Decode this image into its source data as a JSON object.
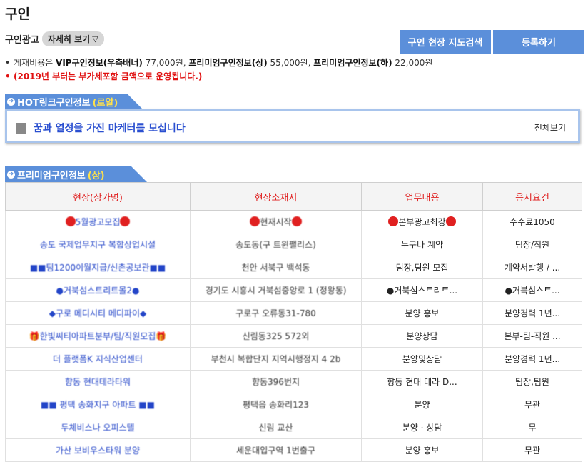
{
  "page": {
    "title": "구인"
  },
  "subheader": {
    "label": "구인광고",
    "detail_button": "자세히 보기",
    "detail_arrow": "▽"
  },
  "buttons": {
    "map_search": "구인 현장 지도검색",
    "register": "등록하기"
  },
  "notes": {
    "fee_prefix": "게재비용은",
    "vip_label": "VIP구인정보(우측배너)",
    "vip_price": "77,000원,",
    "premium_top_label": "프리미엄구인정보(상)",
    "premium_top_price": "55,000원,",
    "premium_bottom_label": "프리미엄구인정보(하)",
    "premium_bottom_price": "22,000원",
    "vat_notice": "(2019년 부터는 부가세포함 금액으로 운영됩니다.)"
  },
  "hot": {
    "title": "HOT링크구인정보",
    "highlight": "(로얄)",
    "item": "꿈과 열정을 가진 마케터를 모십니다",
    "view_all": "전체보기"
  },
  "premium": {
    "title": "프리미엄구인정보",
    "highlight": "(상)",
    "columns": [
      "현장(상가명)",
      "현장소재지",
      "업무내용",
      "응시요건"
    ],
    "rows": [
      {
        "name": "5월광고모집",
        "addr": "현재시작",
        "job": "본부광고최강",
        "cond": "수수료1050"
      },
      {
        "name": "송도 국제업무지구 복합상업시설",
        "addr": "송도동(구 트윈팰리스)",
        "job": "누구나 계약",
        "cond": "팀장/직원"
      },
      {
        "name": "■■팀1200이월지급/신촌공보관■■",
        "addr": "천안 서북구 백석동",
        "job": "팀장,팀원 모집",
        "cond": "계약서발행 / ..."
      },
      {
        "name": "●거북섬스트리트몰2●",
        "addr": "경기도 시흥시 거북섬중앙로 1 (정왕동)",
        "job": "●거북섬스트리트...",
        "cond": "●거북섬스트..."
      },
      {
        "name": "◆구로 메디시티 메디파이◆",
        "addr": "구로구 오류동31-780",
        "job": "분양 홍보",
        "cond": "분양경력 1년..."
      },
      {
        "name": "🎁한빛씨티아파트분부/팀/직원모집🎁",
        "addr": "신림동325 572외",
        "job": "분양상담",
        "cond": "본부-팀-직원 ..."
      },
      {
        "name": "더 플랫폼K 지식산업센터",
        "addr": "부천시 복합단지 지역시행정지 4 2b",
        "job": "분양및상담",
        "cond": "분양경력 1년..."
      },
      {
        "name": "향동 현대테라타워",
        "addr": "향동396번지",
        "job": "향동 현대 테라 D...",
        "cond": "팀장,팀원"
      },
      {
        "name": "■■ 평택 송화지구 아파트 ■■",
        "addr": "평택읍 송화리123",
        "job": "분양",
        "cond": "무관"
      },
      {
        "name": "두체비스나 오피스텔",
        "addr": "신림 교산",
        "job": "분양 · 상담",
        "cond": "무"
      },
      {
        "name": "가산 보비우스타워 분양",
        "addr": "세운대입구역 1번출구",
        "job": "분양 홍보",
        "cond": "무관"
      }
    ]
  },
  "colors": {
    "accent_blue": "#5b8fda",
    "link_blue": "#2345c8",
    "header_red": "#e02020",
    "notice_red": "#e01010"
  }
}
